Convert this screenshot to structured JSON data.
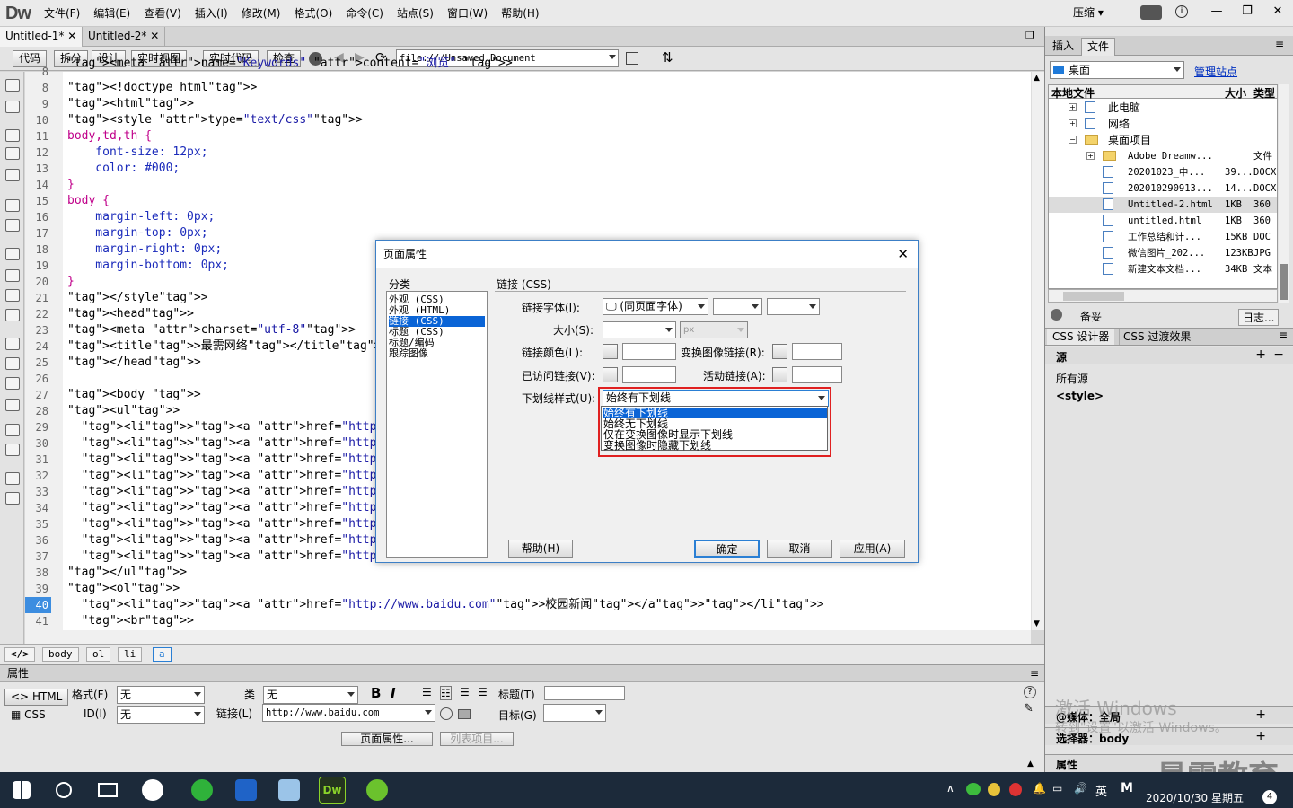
{
  "app": {
    "logo": "Dw",
    "menus": [
      "文件(F)",
      "编辑(E)",
      "查看(V)",
      "插入(I)",
      "修改(M)",
      "格式(O)",
      "命令(C)",
      "站点(S)",
      "窗口(W)",
      "帮助(H)"
    ],
    "compress": "压缩"
  },
  "doc_tabs": [
    "Untitled-1*",
    "Untitled-2*"
  ],
  "toolbar": {
    "code": "代码",
    "split": "拆分",
    "design": "设计",
    "live_view": "实时视图",
    "live_code": "实时代码",
    "inspect": "检查",
    "address": "file:///Unsaved_Document"
  },
  "code_lines": [
    {
      "n": "8",
      "t": "<meta name=\"Keywords\" content=\"浏览\" >"
    },
    {
      "n": "8",
      "t": "<!doctype html>"
    },
    {
      "n": "9",
      "t": "<html>"
    },
    {
      "n": "10",
      "t": "<style type=\"text/css\">"
    },
    {
      "n": "11",
      "t": "body,td,th {"
    },
    {
      "n": "12",
      "t": "    font-size: 12px;"
    },
    {
      "n": "13",
      "t": "    color: #000;"
    },
    {
      "n": "14",
      "t": "}"
    },
    {
      "n": "15",
      "t": "body {"
    },
    {
      "n": "16",
      "t": "    margin-left: 0px;"
    },
    {
      "n": "17",
      "t": "    margin-top: 0px;"
    },
    {
      "n": "18",
      "t": "    margin-right: 0px;"
    },
    {
      "n": "19",
      "t": "    margin-bottom: 0px;"
    },
    {
      "n": "20",
      "t": "}"
    },
    {
      "n": "21",
      "t": "</style>"
    },
    {
      "n": "22",
      "t": "<head>"
    },
    {
      "n": "23",
      "t": "<meta charset=\"utf-8\">"
    },
    {
      "n": "24",
      "t": "<title>最需网络</title>"
    },
    {
      "n": "25",
      "t": "</head>"
    },
    {
      "n": "26",
      "t": ""
    },
    {
      "n": "27",
      "t": "<body >"
    },
    {
      "n": "28",
      "t": "<ul>"
    },
    {
      "n": "29",
      "t": "  <li><a href=\"http://www.baidu.com\">娱乐新闻</a></li>"
    },
    {
      "n": "30",
      "t": "  <li><a href=\"http://www.baidu.com\">财经新闻</a></li>"
    },
    {
      "n": "31",
      "t": "  <li><a href=\"http://www.baidu.com\">军事新闻</a></li>"
    },
    {
      "n": "32",
      "t": "  <li><a href=\"http://www.baidu.com\">社会新闻</a></li>"
    },
    {
      "n": "33",
      "t": "  <li><a href=\"http://www.baidu.com\">校园新闻</a></li>"
    },
    {
      "n": "34",
      "t": "  <li><a href=\"http://www.baidu.com\">娱乐新闻</a></li>"
    },
    {
      "n": "35",
      "t": "  <li><a href=\"http://www.baidu.com\">财经新闻</a></li>"
    },
    {
      "n": "36",
      "t": "  <li><a href=\"http://www.baidu.com\">军事新闻</a></li>"
    },
    {
      "n": "37",
      "t": "  <li><a href=\"http://www.baidu.com\">社会新闻</a></li>"
    },
    {
      "n": "38",
      "t": "</ul>"
    },
    {
      "n": "39",
      "t": "<ol>"
    },
    {
      "n": "40",
      "t": "  <li><a href=\"http://www.baidu.com\">校园新闻</a></li>"
    },
    {
      "n": "41",
      "t": "  <br>"
    }
  ],
  "breadcrumbs": [
    "body",
    "ol",
    "li",
    "a"
  ],
  "properties": {
    "title": "属性",
    "html": "HTML",
    "css": "CSS",
    "format_label": "格式(F)",
    "format_value": "无",
    "id_label": "ID(I)",
    "id_value": "无",
    "class_label": "类",
    "class_value": "无",
    "link_label": "链接(L)",
    "link_value": "http://www.baidu.com",
    "title_label": "标题(T)",
    "target_label": "目标(G)",
    "page_props": "页面属性...",
    "list_item": "列表项目..."
  },
  "right_panel": {
    "tab_insert": "插入",
    "tab_files": "文件",
    "site": "桌面",
    "manage": "管理站点",
    "col_local": "本地文件",
    "col_size": "大小",
    "col_type": "类型",
    "bottom_label": "备妥",
    "log": "日志...",
    "css_tab": "CSS 设计器",
    "css_trans": "CSS 过渡效果",
    "source": "源",
    "all_sources": "所有源",
    "style": "<style>",
    "media": "@媒体：全局",
    "selector": "选择器：body",
    "props": "属性"
  },
  "files": [
    {
      "name": "此电脑",
      "size": "",
      "type": ""
    },
    {
      "name": "网络",
      "size": "",
      "type": ""
    },
    {
      "name": "桌面项目",
      "size": "",
      "type": ""
    },
    {
      "name": "Adobe Dreamw...",
      "size": "",
      "type": "文件"
    },
    {
      "name": "20201023_中...",
      "size": "39...",
      "type": "DOCX"
    },
    {
      "name": "202010290913...",
      "size": "14...",
      "type": "DOCX"
    },
    {
      "name": "Untitled-2.html",
      "size": "1KB",
      "type": "360"
    },
    {
      "name": "untitled.html",
      "size": "1KB",
      "type": "360"
    },
    {
      "name": "工作总结和计...",
      "size": "15KB",
      "type": "DOC"
    },
    {
      "name": "微信图片_202...",
      "size": "123KB",
      "type": "JPG"
    },
    {
      "name": "新建文本文档...",
      "size": "34KB",
      "type": "文本"
    }
  ],
  "dialog": {
    "title": "页面属性",
    "cat_header": "分类",
    "section": "链接 (CSS)",
    "categories": [
      "外观 (CSS)",
      "外观 (HTML)",
      "链接 (CSS)",
      "标题 (CSS)",
      "标题/编码",
      "跟踪图像"
    ],
    "font_label": "链接字体(I):",
    "font_value": "(同页面字体)",
    "size_label": "大小(S):",
    "unit": "px",
    "color_label": "链接颜色(L):",
    "rollover_label": "变换图像链接(R):",
    "visited_label": "已访问链接(V):",
    "active_label": "活动链接(A):",
    "underline_label": "下划线样式(U):",
    "underline_value": "始终有下划线",
    "underline_options": [
      "始终有下划线",
      "始终无下划线",
      "仅在变换图像时显示下划线",
      "变换图像时隐藏下划线"
    ],
    "help": "帮助(H)",
    "ok": "确定",
    "cancel": "取消",
    "apply": "应用(A)"
  },
  "watermark": {
    "line1": "激活 Windows",
    "line2": "转到\"设置\"以激活 Windows。",
    "brand": "最需教育"
  },
  "taskbar": {
    "ime": "英",
    "datetime": "2020/10/30 星期五",
    "notif": "4"
  }
}
